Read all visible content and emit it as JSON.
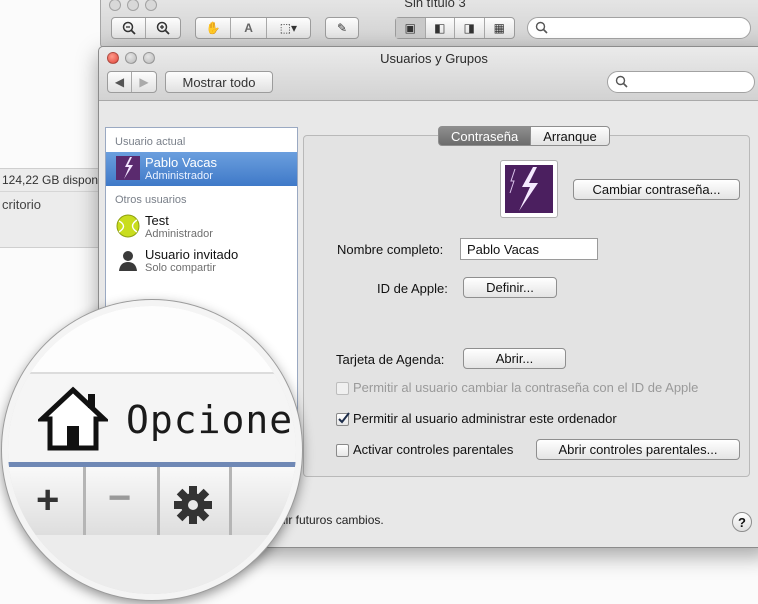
{
  "background": {
    "disk_text": "124,22 GB dispon",
    "item_text": "critorio"
  },
  "back_window": {
    "title": "Sin título 3"
  },
  "window": {
    "title": "Usuarios y Grupos",
    "show_all_label": "Mostrar todo",
    "search_placeholder": ""
  },
  "sidebar": {
    "current_section": "Usuario actual",
    "other_section": "Otros usuarios",
    "users": [
      {
        "name": "Pablo Vacas",
        "role": "Administrador",
        "selected": true
      },
      {
        "name": "Test",
        "role": "Administrador",
        "selected": false
      },
      {
        "name": "Usuario invitado",
        "role": "Solo compartir",
        "selected": false
      }
    ]
  },
  "tabs": [
    {
      "label": "Contraseña",
      "active": true
    },
    {
      "label": "Arranque",
      "active": false
    }
  ],
  "form": {
    "change_password_label": "Cambiar contraseña...",
    "full_name_label": "Nombre completo:",
    "full_name_value": "Pablo Vacas",
    "apple_id_label": "ID de Apple:",
    "apple_id_button": "Definir...",
    "address_card_label": "Tarjeta de Agenda:",
    "address_card_button": "Abrir...",
    "allow_reset_label": "Permitir al usuario cambiar la contraseña con el ID de Apple",
    "allow_admin_label": "Permitir al usuario administrar este ordenador",
    "parental_label": "Activar controles parentales",
    "parental_button": "Abrir controles parentales...",
    "allow_reset_checked": false,
    "allow_admin_checked": true,
    "parental_checked": false
  },
  "footer": {
    "lock_text": "dir futuros cambios.",
    "help_label": "?"
  },
  "magnifier": {
    "options_label": "Opciones",
    "add_label": "+",
    "remove_label": "−"
  }
}
